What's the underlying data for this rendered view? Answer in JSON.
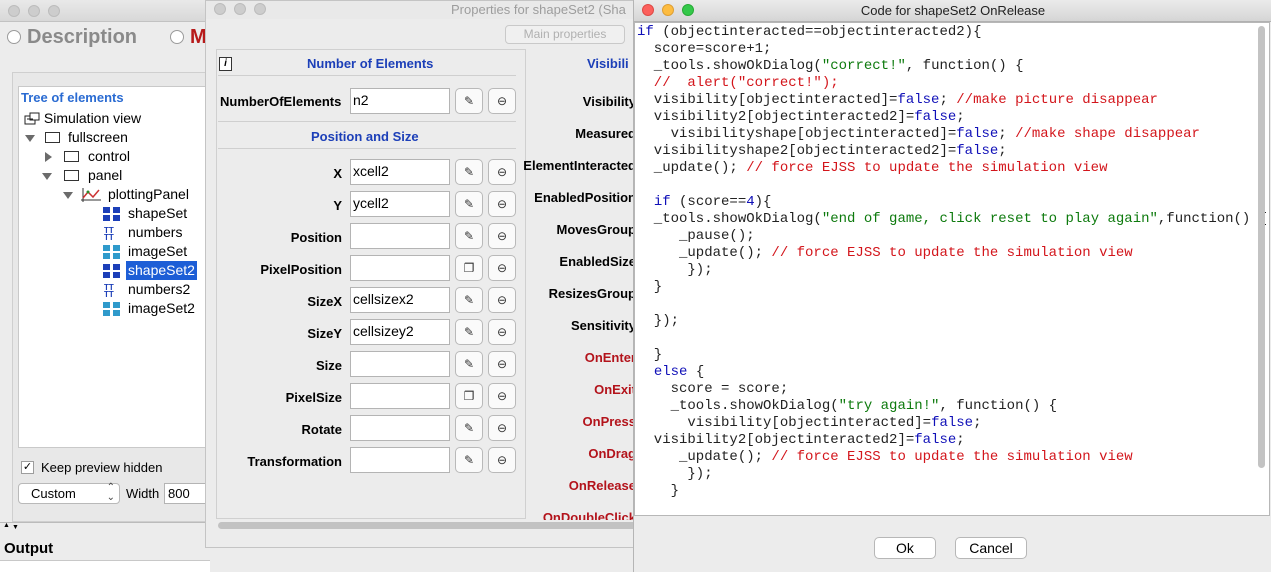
{
  "main_window": {
    "tabs": [
      {
        "label": "Description"
      },
      {
        "label": "M"
      }
    ],
    "tree_title": "Tree of elements",
    "tree": [
      {
        "label": "Simulation view"
      },
      {
        "label": "fullscreen"
      },
      {
        "label": "control"
      },
      {
        "label": "panel"
      },
      {
        "label": "plottingPanel"
      },
      {
        "label": "shapeSet"
      },
      {
        "label": "numbers"
      },
      {
        "label": "imageSet"
      },
      {
        "label": "shapeSet2"
      },
      {
        "label": "numbers2"
      },
      {
        "label": "imageSet2"
      }
    ],
    "keep_preview_label": "Keep preview hidden",
    "size_mode": "Custom",
    "width_label": "Width",
    "width_value": "800",
    "output_label": "Output"
  },
  "props_window": {
    "title": "Properties for shapeSet2 (Sha",
    "main_properties_button": "Main properties",
    "sections": {
      "elements": "Number of Elements",
      "position": "Position and Size",
      "visibility": "Visibili"
    },
    "fields": [
      {
        "label": "NumberOfElements",
        "value": "n2"
      },
      {
        "label": "X",
        "value": "xcell2"
      },
      {
        "label": "Y",
        "value": "ycell2"
      },
      {
        "label": "Position",
        "value": ""
      },
      {
        "label": "PixelPosition",
        "value": ""
      },
      {
        "label": "SizeX",
        "value": "cellsizex2"
      },
      {
        "label": "SizeY",
        "value": "cellsizey2"
      },
      {
        "label": "Size",
        "value": ""
      },
      {
        "label": "PixelSize",
        "value": ""
      },
      {
        "label": "Rotate",
        "value": ""
      },
      {
        "label": "Transformation",
        "value": ""
      }
    ],
    "right_labels": [
      "Visibility",
      "Measured",
      "ElementInteracted",
      "EnabledPosition",
      "MovesGroup",
      "EnabledSize",
      "ResizesGroup",
      "Sensitivity"
    ],
    "event_labels": [
      "OnEnter",
      "OnExit",
      "OnPress",
      "OnDrag",
      "OnRelease",
      "OnDoubleClick"
    ]
  },
  "code_window": {
    "title": "Code for shapeSet2 OnRelease",
    "ok_label": "Ok",
    "cancel_label": "Cancel",
    "lines": [
      [
        [
          "kw",
          "if"
        ],
        [
          "pl",
          " (objectinteracted==objectinteracted2){"
        ]
      ],
      [
        [
          "pl",
          "  score=score+1;"
        ]
      ],
      [
        [
          "pl",
          "  _tools.showOkDialog("
        ],
        [
          "st",
          "\"correct!\""
        ],
        [
          "pl",
          ", function() {"
        ]
      ],
      [
        [
          "cm",
          "  //  alert(\"correct!\");"
        ]
      ],
      [
        [
          "pl",
          "  visibility[objectinteracted]="
        ],
        [
          "kw",
          "false"
        ],
        [
          "pl",
          "; "
        ],
        [
          "cm",
          "//make picture disappear"
        ]
      ],
      [
        [
          "pl",
          "  visibility2[objectinteracted2]="
        ],
        [
          "kw",
          "false"
        ],
        [
          "pl",
          ";"
        ]
      ],
      [
        [
          "pl",
          "    visibilityshape[objectinteracted]="
        ],
        [
          "kw",
          "false"
        ],
        [
          "pl",
          "; "
        ],
        [
          "cm",
          "//make shape disappear"
        ]
      ],
      [
        [
          "pl",
          "  visibilityshape2[objectinteracted2]="
        ],
        [
          "kw",
          "false"
        ],
        [
          "pl",
          ";"
        ]
      ],
      [
        [
          "pl",
          "  _update(); "
        ],
        [
          "cm",
          "// force EJSS to update the simulation view"
        ]
      ],
      [
        [
          "pl",
          ""
        ]
      ],
      [
        [
          "pl",
          "  "
        ],
        [
          "kw",
          "if"
        ],
        [
          "pl",
          " (score=="
        ],
        [
          "kw",
          "4"
        ],
        [
          "pl",
          "){"
        ]
      ],
      [
        [
          "pl",
          "  _tools.showOkDialog("
        ],
        [
          "st",
          "\"end of game, click reset to play again\""
        ],
        [
          "pl",
          ",function() {"
        ]
      ],
      [
        [
          "pl",
          "     _pause();"
        ]
      ],
      [
        [
          "pl",
          "     _update(); "
        ],
        [
          "cm",
          "// force EJSS to update the simulation view"
        ]
      ],
      [
        [
          "pl",
          "      });"
        ]
      ],
      [
        [
          "pl",
          "  }"
        ]
      ],
      [
        [
          "pl",
          ""
        ]
      ],
      [
        [
          "pl",
          "  });"
        ]
      ],
      [
        [
          "pl",
          ""
        ]
      ],
      [
        [
          "pl",
          "  }"
        ]
      ],
      [
        [
          "pl",
          "  "
        ],
        [
          "kw",
          "else"
        ],
        [
          "pl",
          " {"
        ]
      ],
      [
        [
          "pl",
          "    score = score;"
        ]
      ],
      [
        [
          "pl",
          "    _tools.showOkDialog("
        ],
        [
          "st",
          "\"try again!\""
        ],
        [
          "pl",
          ", function() {"
        ]
      ],
      [
        [
          "pl",
          "      visibility[objectinteracted]="
        ],
        [
          "kw",
          "false"
        ],
        [
          "pl",
          ";"
        ]
      ],
      [
        [
          "pl",
          "  visibility2[objectinteracted2]="
        ],
        [
          "kw",
          "false"
        ],
        [
          "pl",
          ";"
        ]
      ],
      [
        [
          "pl",
          "     _update(); "
        ],
        [
          "cm",
          "// force EJSS to update the simulation view"
        ]
      ],
      [
        [
          "pl",
          "      });"
        ]
      ],
      [
        [
          "pl",
          "    }"
        ]
      ]
    ]
  },
  "colors": {
    "keyword": "#1010b8",
    "comment": "#d3151b",
    "string": "#0d7a0d",
    "section_title": "#1c3fb8",
    "event_label": "#b3131b",
    "selection": "#1d5ed6"
  }
}
